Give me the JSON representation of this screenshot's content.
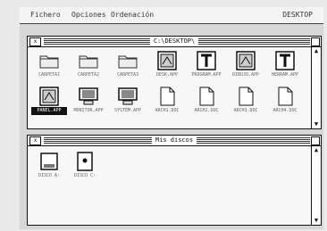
{
  "menubar": {
    "items": [
      "Fichero",
      "Opciones",
      "Ordenación"
    ],
    "right_label": "DESKTOP"
  },
  "main_window": {
    "title": "C:\\DESKTOP\\",
    "close_label": "x",
    "icons": [
      {
        "label": "CARPETA1",
        "kind": "folder",
        "selected": false
      },
      {
        "label": "CARPETA2",
        "kind": "folder",
        "selected": false
      },
      {
        "label": "CARPETA3",
        "kind": "folder",
        "selected": false
      },
      {
        "label": "DESK.APP",
        "kind": "app",
        "selected": false
      },
      {
        "label": "PROGRAM.APP",
        "kind": "app-t",
        "selected": false
      },
      {
        "label": "DIBUJO.APP",
        "kind": "app",
        "selected": false
      },
      {
        "label": "HERRAM.APP",
        "kind": "app-t",
        "selected": false
      },
      {
        "label": "PANEL.APP",
        "kind": "app",
        "selected": true
      },
      {
        "label": "MONITOR.APP",
        "kind": "monitor",
        "selected": false
      },
      {
        "label": "SYSTEM.APP",
        "kind": "monitor",
        "selected": false
      },
      {
        "label": "ARCH1.DOC",
        "kind": "doc",
        "selected": false
      },
      {
        "label": "ARCH2.DOC",
        "kind": "doc",
        "selected": false
      },
      {
        "label": "ARCH3.DOC",
        "kind": "doc",
        "selected": false
      },
      {
        "label": "ARCH4.DOC",
        "kind": "doc",
        "selected": false
      }
    ]
  },
  "disk_window": {
    "title": "Mis discos",
    "close_label": "x",
    "icons": [
      {
        "label": "DISCO A:",
        "kind": "floppy"
      },
      {
        "label": "DISCO C:",
        "kind": "hdd"
      }
    ]
  }
}
